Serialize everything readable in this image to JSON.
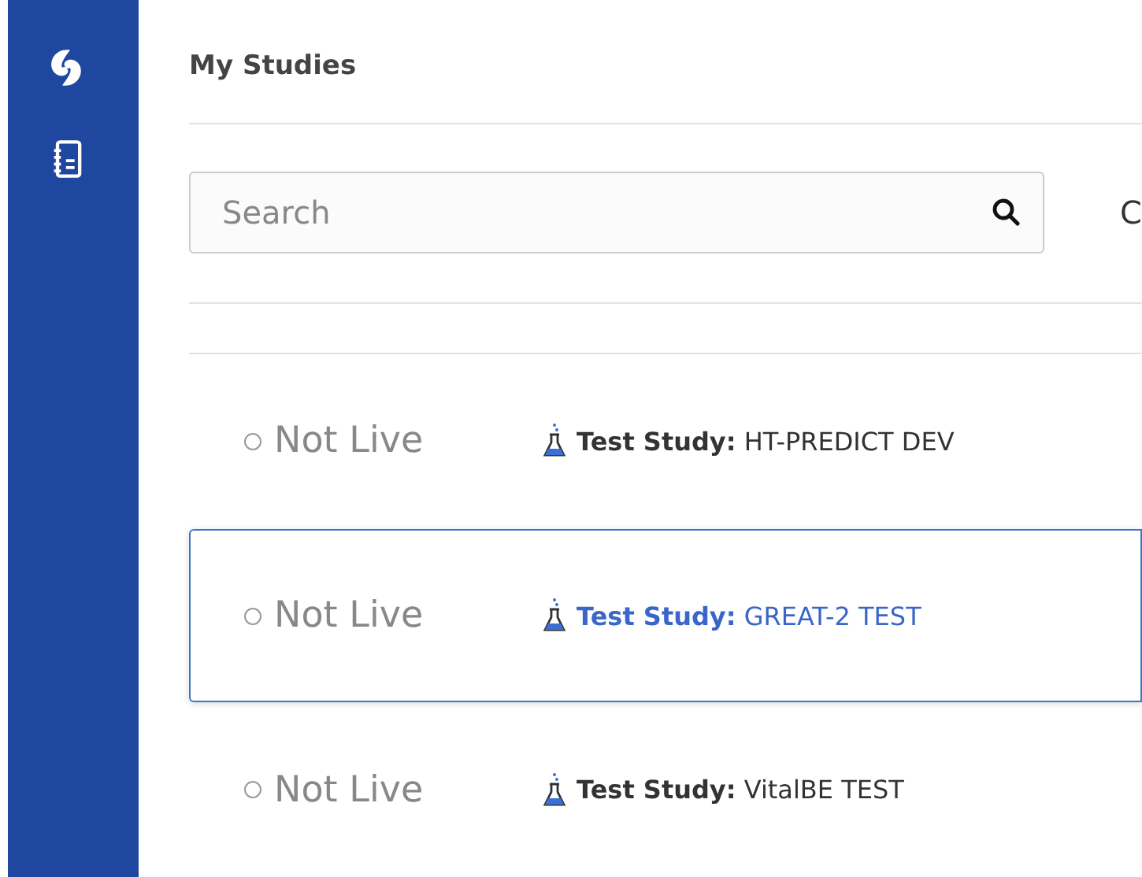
{
  "sidebar": {
    "items": [
      {
        "kind": "logo"
      },
      {
        "kind": "notebook"
      }
    ]
  },
  "page": {
    "title": "My Studies"
  },
  "search": {
    "placeholder": "Search"
  },
  "cut_text": "C",
  "studies": [
    {
      "status": "Not Live",
      "prefix": "Test Study:",
      "name": "HT-PREDICT DEV",
      "selected": false
    },
    {
      "status": "Not Live",
      "prefix": "Test Study:",
      "name": "GREAT-2 TEST",
      "selected": true
    },
    {
      "status": "Not Live",
      "prefix": "Test Study:",
      "name": "VitalBE TEST",
      "selected": false
    }
  ]
}
